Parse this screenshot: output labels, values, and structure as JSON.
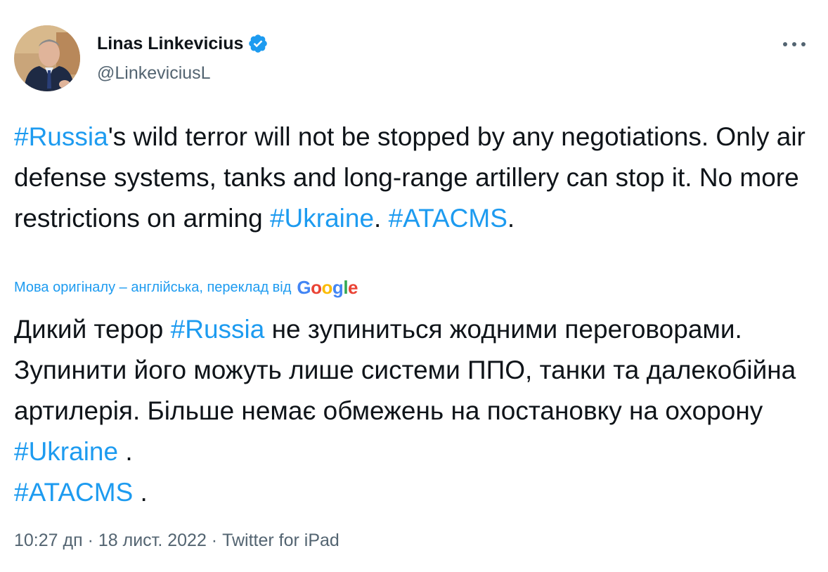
{
  "author": {
    "display_name": "Linas Linkevicius",
    "handle": "@LinkeviciusL",
    "verified": true,
    "avatar_icon": "profile-photo"
  },
  "menu_icon": "more-horizontal-icon",
  "tweet": {
    "original": {
      "tag_russia": "#Russia",
      "seg1": "'s wild terror will not be stopped by any negotiations. Only air defense systems, tanks and long-range artillery can stop it. No more restrictions on arming ",
      "tag_ukraine": "#Ukraine",
      "seg2": ". ",
      "tag_atacms": "#ATACMS",
      "seg3": "."
    },
    "translation_note": "Мова оригіналу – англійська, переклад від",
    "translation_provider": "Google",
    "translated": {
      "seg0": "Дикий терор ",
      "tag_russia": "#Russia",
      "seg1": " не зупиниться жодними переговорами. Зупинити його можуть лише системи ППО, танки та далекобійна артилерія. Більше немає обмежень на постановку на охорону ",
      "tag_ukraine": "#Ukraine",
      "seg2": " . ",
      "tag_atacms": "#ATACMS",
      "seg3": " ."
    }
  },
  "meta": {
    "time": "10:27 дп",
    "separator": " · ",
    "date": "18 лист. 2022",
    "source": "Twitter for iPad"
  },
  "colors": {
    "accent": "#1d9bf0",
    "text": "#0f1419",
    "secondary": "#536471"
  }
}
